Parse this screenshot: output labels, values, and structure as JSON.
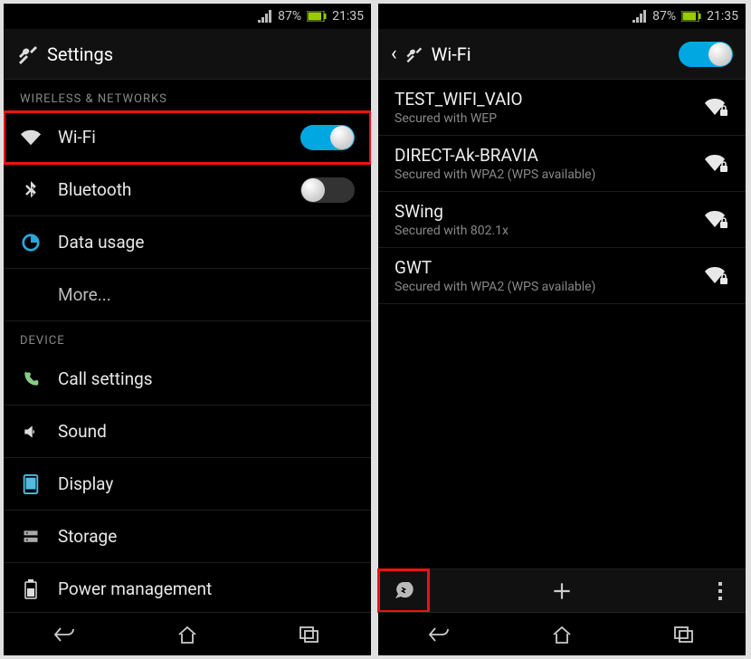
{
  "status": {
    "battery": "87%",
    "time": "21:35"
  },
  "left": {
    "title": "Settings",
    "section_wireless": "WIRELESS & NETWORKS",
    "wifi": "Wi-Fi",
    "bluetooth": "Bluetooth",
    "data_usage": "Data usage",
    "more": "More...",
    "section_device": "DEVICE",
    "call_settings": "Call settings",
    "sound": "Sound",
    "display": "Display",
    "storage": "Storage",
    "power": "Power management"
  },
  "right": {
    "title": "Wi-Fi",
    "networks": [
      {
        "name": "TEST_WIFI_VAIO",
        "sub": "Secured with WEP"
      },
      {
        "name": "DIRECT-Ak-BRAVIA",
        "sub": "Secured with WPA2 (WPS available)"
      },
      {
        "name": "SWing",
        "sub": "Secured with 802.1x"
      },
      {
        "name": "GWT",
        "sub": "Secured with WPA2 (WPS available)"
      }
    ]
  }
}
